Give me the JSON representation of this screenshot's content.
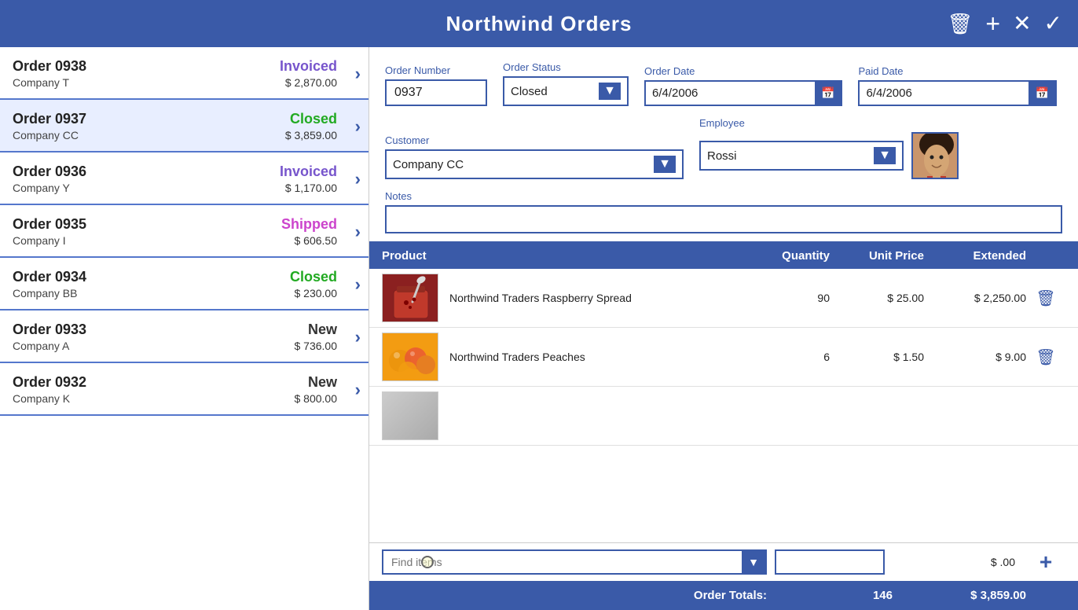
{
  "app": {
    "title": "Northwind Orders",
    "delete_icon": "🗑",
    "add_icon": "+",
    "close_icon": "✕",
    "check_icon": "✓"
  },
  "header": {
    "title": "Northwind Orders"
  },
  "order_list": {
    "items": [
      {
        "id": "0938",
        "name": "Order 0938",
        "company": "Company T",
        "status": "Invoiced",
        "status_class": "status-invoiced",
        "amount": "$ 2,870.00"
      },
      {
        "id": "0937",
        "name": "Order 0937",
        "company": "Company CC",
        "status": "Closed",
        "status_class": "status-closed",
        "amount": "$ 3,859.00",
        "selected": true
      },
      {
        "id": "0936",
        "name": "Order 0936",
        "company": "Company Y",
        "status": "Invoiced",
        "status_class": "status-invoiced",
        "amount": "$ 1,170.00"
      },
      {
        "id": "0935",
        "name": "Order 0935",
        "company": "Company I",
        "status": "Shipped",
        "status_class": "status-shipped",
        "amount": "$ 606.50"
      },
      {
        "id": "0934",
        "name": "Order 0934",
        "company": "Company BB",
        "status": "Closed",
        "status_class": "status-closed",
        "amount": "$ 230.00"
      },
      {
        "id": "0933",
        "name": "Order 0933",
        "company": "Company A",
        "status": "New",
        "status_class": "status-new",
        "amount": "$ 736.00"
      },
      {
        "id": "0932",
        "name": "Order 0932",
        "company": "Company K",
        "status": "New",
        "status_class": "status-new",
        "amount": "$ 800.00"
      }
    ]
  },
  "detail": {
    "order_number_label": "Order Number",
    "order_number_value": "0937",
    "order_status_label": "Order Status",
    "order_status_value": "Closed",
    "order_date_label": "Order Date",
    "order_date_value": "6/4/2006",
    "paid_date_label": "Paid Date",
    "paid_date_value": "6/4/2006",
    "customer_label": "Customer",
    "customer_value": "Company CC",
    "employee_label": "Employee",
    "employee_value": "Rossi",
    "notes_label": "Notes",
    "notes_value": "",
    "products_col_product": "Product",
    "products_col_qty": "Quantity",
    "products_col_price": "Unit Price",
    "products_col_ext": "Extended",
    "products": [
      {
        "name": "Northwind Traders Raspberry Spread",
        "qty": "90",
        "unit_price": "$ 25.00",
        "extended": "$ 2,250.00",
        "thumb_class": "thumb-raspberry"
      },
      {
        "name": "Northwind Traders Peaches",
        "qty": "6",
        "unit_price": "$ 1.50",
        "extended": "$ 9.00",
        "thumb_class": "thumb-peach"
      },
      {
        "name": "",
        "qty": "",
        "unit_price": "",
        "extended": "",
        "thumb_class": "thumb-partial"
      }
    ],
    "find_items_placeholder": "Find items",
    "add_qty_value": "",
    "ext_display": "$ .00",
    "totals_label": "Order Totals:",
    "totals_qty": "146",
    "totals_amount": "$ 3,859.00"
  }
}
